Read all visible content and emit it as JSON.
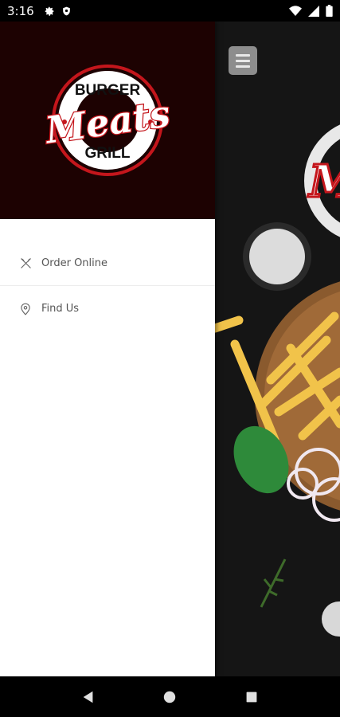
{
  "status_bar": {
    "time": "3:16",
    "left_icons": [
      "gear-icon",
      "shield-icon"
    ],
    "right_icons": [
      "wifi-icon",
      "signal-icon",
      "battery-icon"
    ]
  },
  "drawer": {
    "logo": {
      "top_text": "BURGER",
      "script_text": "Meats",
      "bottom_text": "GRILL"
    },
    "items": [
      {
        "label": "Order Online",
        "icon": "utensils-icon"
      },
      {
        "label": "Find Us",
        "icon": "location-pin-icon"
      }
    ]
  },
  "background": {
    "menu_icon": "hamburger-menu-icon"
  },
  "nav_bar": {
    "buttons": [
      "back-button",
      "home-button",
      "recents-button"
    ]
  },
  "colors": {
    "header_bg": "#1d0202",
    "brand_red": "#c4161c",
    "drawer_text": "#555555"
  }
}
